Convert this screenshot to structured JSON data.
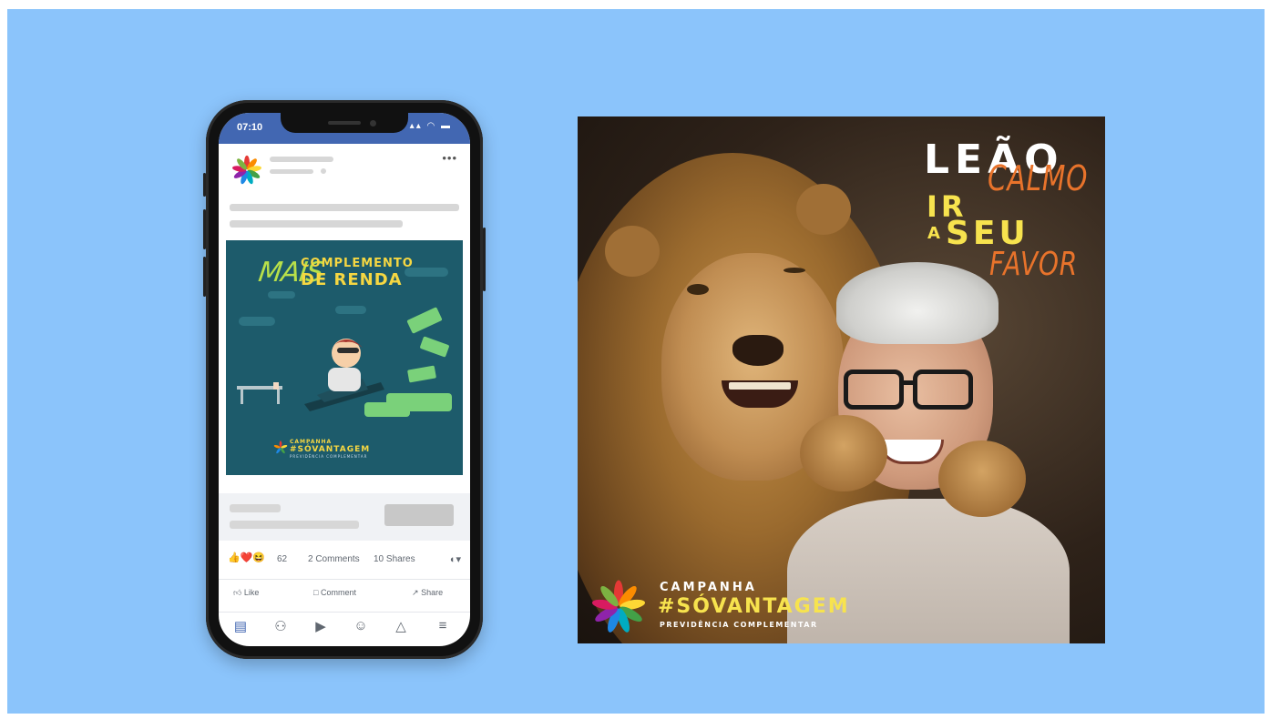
{
  "phone": {
    "status": {
      "time": "07:10",
      "icons": "▴▴ ◠ ▬"
    },
    "post": {
      "more_label": "•••",
      "ad": {
        "mais": "MAIS",
        "headline_line1": "COMPLEMENTO",
        "headline_line2": "DE RENDA",
        "campanha": "CAMPANHA",
        "hashtag": "#SÓVANTAGEM",
        "subtitle": "PREVIDÊNCIA COMPLEMENTAR"
      },
      "reactions": {
        "emojis": "👍❤️😆",
        "count": "62",
        "comments": "2 Comments",
        "shares": "10 Shares",
        "viewers_icon": "◐▾"
      },
      "actions": {
        "like": "Like",
        "comment": "Comment",
        "share": "Share"
      }
    },
    "tabbar": [
      {
        "name": "tab-home",
        "icon": "▤"
      },
      {
        "name": "tab-friends",
        "icon": "⚇"
      },
      {
        "name": "tab-watch",
        "icon": "▶"
      },
      {
        "name": "tab-profile",
        "icon": "☺"
      },
      {
        "name": "tab-notifications",
        "icon": "△"
      },
      {
        "name": "tab-menu",
        "icon": "≡"
      }
    ]
  },
  "poster": {
    "headline": {
      "leao": "LEÃO",
      "calmo": "CALMO",
      "ir": "IR",
      "a": "A",
      "seu": "SEU",
      "favor": "FAVOR"
    },
    "brand": {
      "campanha": "CAMPANHA",
      "hashtag": "#SÓVANTAGEM",
      "subtitle": "PREVIDÊNCIA COMPLEMENTAR"
    }
  },
  "colors": {
    "background": "#8bc4fb",
    "facebook_blue": "#4267b2",
    "yellow": "#f7e34e",
    "orange": "#e8732b",
    "ad_teal": "#1d5b6b"
  }
}
